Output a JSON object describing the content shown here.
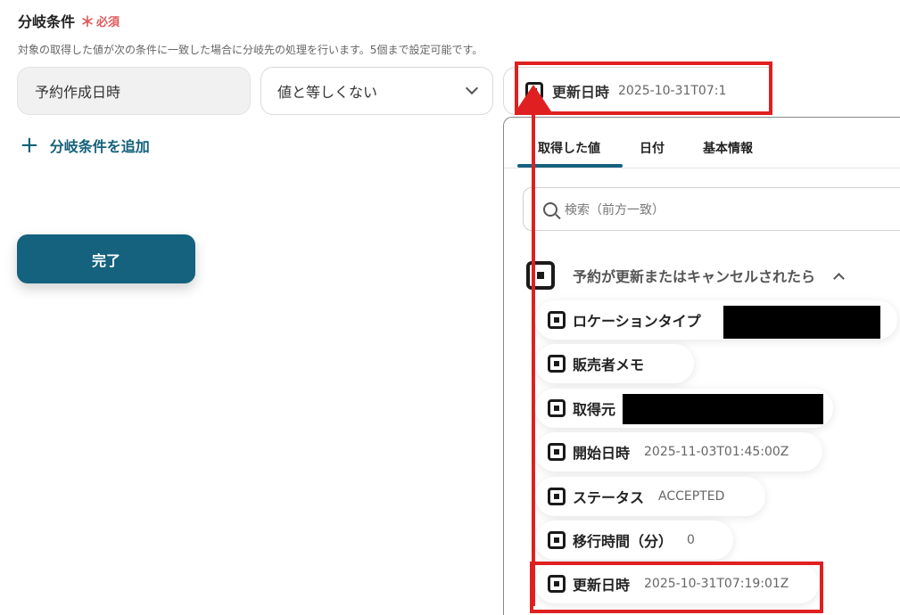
{
  "section": {
    "title": "分岐条件",
    "required_mark": "＊",
    "required_label": "必須",
    "description": "対象の取得した値が次の条件に一致した場合に分岐先の処理を行います。5個まで設定可能です。"
  },
  "condition": {
    "value_field": "予約作成日時",
    "operator": "値と等しくない",
    "target_label": "更新日時",
    "target_value": "2025-10-31T07:1"
  },
  "add_condition_label": "分岐条件を追加",
  "done_label": "完了",
  "panel": {
    "tabs": [
      "取得した値",
      "日付",
      "基本情報"
    ],
    "search_placeholder": "検索（前方一致）",
    "group_label": "予約が更新またはキャンセルされたら",
    "items": [
      {
        "label": "ロケーションタイプ",
        "value": ""
      },
      {
        "label": "販売者メモ",
        "value": ""
      },
      {
        "label": "取得元",
        "value": ""
      },
      {
        "label": "開始日時",
        "value": "2025-11-03T01:45:00Z"
      },
      {
        "label": "ステータス",
        "value": "ACCEPTED"
      },
      {
        "label": "移行時間（分）",
        "value": "0"
      },
      {
        "label": "更新日時",
        "value": "2025-10-31T07:19:01Z"
      }
    ]
  },
  "colors": {
    "accent": "#14627e",
    "required": "#e05a5a",
    "annotation": "#e02020"
  }
}
